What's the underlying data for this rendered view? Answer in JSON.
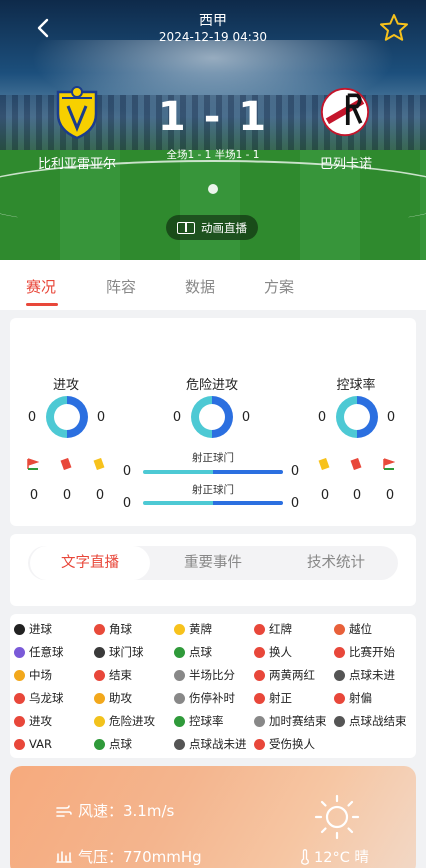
{
  "header": {
    "league": "西甲",
    "datetime": "2024-12-19 04:30",
    "home_team": "比利亚雷亚尔",
    "away_team": "巴列卡诺",
    "home_score": "1",
    "score_sep": "-",
    "away_score": "1",
    "half_info": "全场1 - 1 半场1 - 1",
    "anim_label": "动画直播"
  },
  "tabs": [
    "赛况",
    "阵容",
    "数据",
    "方案"
  ],
  "stats": {
    "attack": {
      "label": "进攻",
      "home": "0",
      "away": "0"
    },
    "danger": {
      "label": "危险进攻",
      "home": "0",
      "away": "0"
    },
    "possession": {
      "label": "控球率",
      "home": "0",
      "away": "0"
    },
    "home_cards": {
      "corner": "0",
      "red": "0",
      "yellow": "0"
    },
    "away_cards": {
      "yellow": "0",
      "red": "0",
      "corner": "0"
    },
    "shots_on": {
      "label": "射正球门",
      "home": "0",
      "away": "0"
    },
    "shots_on2": {
      "label": "射正球门",
      "home": "0",
      "away": "0"
    }
  },
  "switcher": [
    "文字直播",
    "重要事件",
    "技术统计"
  ],
  "legend": [
    {
      "label": "进球",
      "color": "#222222"
    },
    {
      "label": "角球",
      "color": "#e84a3a"
    },
    {
      "label": "黄牌",
      "color": "#f7c21c"
    },
    {
      "label": "红牌",
      "color": "#e8473a"
    },
    {
      "label": "越位",
      "color": "#e8603a"
    },
    {
      "label": "任意球",
      "color": "#7a5ad8"
    },
    {
      "label": "球门球",
      "color": "#3a3a3a"
    },
    {
      "label": "点球",
      "color": "#2f9a3a"
    },
    {
      "label": "换人",
      "color": "#e8473a"
    },
    {
      "label": "比赛开始",
      "color": "#e8473a"
    },
    {
      "label": "中场",
      "color": "#f2a81c"
    },
    {
      "label": "结束",
      "color": "#e8473a"
    },
    {
      "label": "半场比分",
      "color": "#888888"
    },
    {
      "label": "两黄两红",
      "color": "#e8473a"
    },
    {
      "label": "点球未进",
      "color": "#555555"
    },
    {
      "label": "乌龙球",
      "color": "#e8473a"
    },
    {
      "label": "助攻",
      "color": "#f2a81c"
    },
    {
      "label": "伤停补时",
      "color": "#888888"
    },
    {
      "label": "射正",
      "color": "#e8473a"
    },
    {
      "label": "射偏",
      "color": "#e8473a"
    },
    {
      "label": "进攻",
      "color": "#e8473a"
    },
    {
      "label": "危险进攻",
      "color": "#f2c21c"
    },
    {
      "label": "控球率",
      "color": "#2f9a3a"
    },
    {
      "label": "加时赛结束",
      "color": "#888888"
    },
    {
      "label": "点球战结束",
      "color": "#555555"
    },
    {
      "label": "VAR",
      "color": "#e8473a"
    },
    {
      "label": "点球",
      "color": "#2f9a3a"
    },
    {
      "label": "点球战未进",
      "color": "#555555"
    },
    {
      "label": "受伤换人",
      "color": "#e8473a"
    }
  ],
  "weather": {
    "wind": "风速：3.1m/s",
    "pressure": "气压：770mmHg",
    "temp": "12°C 晴"
  }
}
